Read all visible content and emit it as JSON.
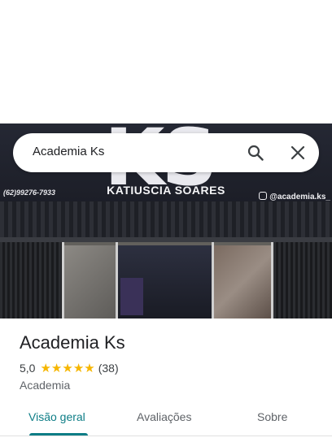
{
  "photo": {
    "sign_logo": "KS",
    "sign_name": "KATIUSCIA SOARES",
    "sign_phone": "(62)99276-7933",
    "sign_instagram": "@academia.ks_"
  },
  "search": {
    "value": "Academia Ks",
    "search_icon": "search-icon",
    "close_icon": "close-icon"
  },
  "place": {
    "name": "Academia Ks",
    "rating": "5,0",
    "stars": 5,
    "review_count": "(38)",
    "category": "Academia"
  },
  "tabs": [
    {
      "label": "Visão geral",
      "active": true
    },
    {
      "label": "Avaliações",
      "active": false
    },
    {
      "label": "Sobre",
      "active": false
    }
  ],
  "colors": {
    "accent": "#0d7d86",
    "star": "#f6b600",
    "text_primary": "#202124",
    "text_secondary": "#5f6368"
  }
}
